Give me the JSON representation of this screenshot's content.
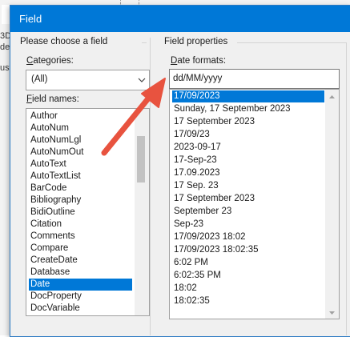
{
  "background": {
    "fragments": [
      "3D",
      "del",
      "ustr"
    ]
  },
  "dialog": {
    "title": "Field",
    "left_group": {
      "legend": "Please choose a field",
      "categories_label_accel": "C",
      "categories_label_rest": "ategories:",
      "categories_value": "(All)",
      "field_names_label_accel": "F",
      "field_names_label_rest": "ield names:",
      "field_names": [
        "Author",
        "AutoNum",
        "AutoNumLgl",
        "AutoNumOut",
        "AutoText",
        "AutoTextList",
        "BarCode",
        "Bibliography",
        "BidiOutline",
        "Citation",
        "Comments",
        "Compare",
        "CreateDate",
        "Database",
        "Date",
        "DocProperty",
        "DocVariable"
      ],
      "selected_field": "Date"
    },
    "right_group": {
      "legend": "Field properties",
      "date_formats_label_accel": "D",
      "date_formats_label_rest": "ate formats:",
      "date_format_value": "dd/MM/yyyy",
      "formats": [
        "17/09/2023",
        "Sunday, 17 September 2023",
        "17 September 2023",
        "17/09/23",
        "2023-09-17",
        "17-Sep-23",
        "17.09.2023",
        "17 Sep. 23",
        "17 September 2023",
        "September 23",
        "Sep-23",
        "17/09/2023 18:02",
        "17/09/2023 18:02:35",
        "6:02 PM",
        "6:02:35 PM",
        "18:02",
        "18:02:35"
      ],
      "selected_format": "17/09/2023"
    }
  },
  "colors": {
    "accent": "#0078d7",
    "annotation_arrow": "#e8533f"
  },
  "icons": {
    "combo_arrow": "chevron-down-icon",
    "scroll_up": "triangle-up-icon",
    "scroll_down": "triangle-down-icon"
  }
}
